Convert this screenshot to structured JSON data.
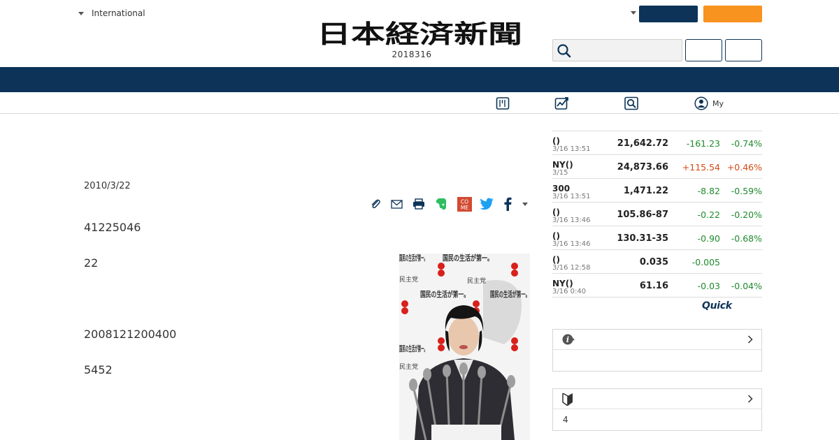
{
  "header": {
    "edition_label": "International",
    "masthead_text": "日本経済新聞",
    "date": "2018316",
    "account_label": "My"
  },
  "article": {
    "date": "2010/3/22",
    "paragraphs": [
      "41225046",
      "22",
      "2008121200400",
      "5452"
    ]
  },
  "photo": {
    "poster_text": "国民の生活が第一。",
    "party_text": "民主党"
  },
  "market": {
    "rows": [
      {
        "name": "()",
        "time": "3/16 13:51",
        "value": "21,642.72",
        "change": "-161.23",
        "percent": "-0.74%",
        "direction": "down"
      },
      {
        "name": "NY()",
        "time": "3/15",
        "value": "24,873.66",
        "change": "+115.54",
        "percent": "+0.46%",
        "direction": "up"
      },
      {
        "name": "300",
        "time": "3/16 13:51",
        "value": "1,471.22",
        "change": "-8.82",
        "percent": "-0.59%",
        "direction": "down"
      },
      {
        "name": "()",
        "time": "3/16 13:46",
        "value": "105.86-87",
        "change": "-0.22",
        "percent": "-0.20%",
        "direction": "down"
      },
      {
        "name": "()",
        "time": "3/16 13:46",
        "value": "130.31-35",
        "change": "-0.90",
        "percent": "-0.68%",
        "direction": "down"
      },
      {
        "name": "()",
        "time": "3/16 12:58",
        "value": "0.035",
        "change": "-0.005",
        "percent": "",
        "direction": "down"
      },
      {
        "name": "NY()",
        "time": "3/16 0:40",
        "value": "61.16",
        "change": "-0.03",
        "percent": "-0.04%",
        "direction": "down"
      }
    ],
    "provider": "Quick"
  },
  "panels": {
    "info_body": "",
    "beginner_body": "4"
  },
  "colors": {
    "navy": "#0d3458",
    "orange": "#f7931e",
    "down": "#1f8a2e",
    "up": "#d24a12"
  },
  "icons": [
    "chevron-down-icon",
    "search-icon",
    "paper-icon",
    "chart-icon",
    "magnifier-icon",
    "user-icon",
    "clip-icon",
    "mail-icon",
    "print-icon",
    "evernote-icon",
    "come-icon",
    "twitter-icon",
    "facebook-icon",
    "info-icon",
    "beginner-icon",
    "chevron-right-icon"
  ]
}
